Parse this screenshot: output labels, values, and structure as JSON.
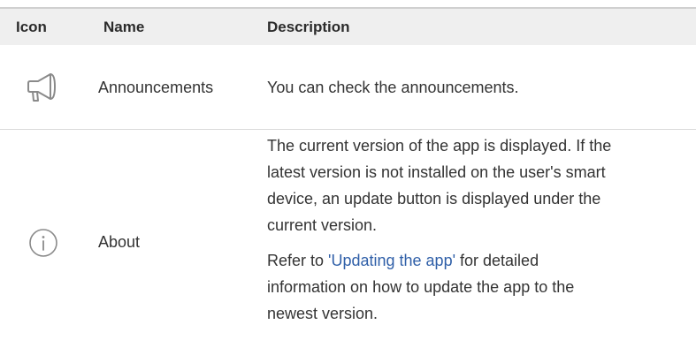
{
  "header": {
    "icon": "Icon",
    "name": "Name",
    "description": "Description"
  },
  "rows": [
    {
      "icon": "megaphone-icon",
      "name": "Announcements",
      "description": "You can check the announcements."
    },
    {
      "icon": "info-icon",
      "name": "About",
      "description_line1": "The current version of the app is displayed. If the",
      "description_line2": "latest version is not installed on the user's smart",
      "description_line3": "device, an update button is displayed under the",
      "description_line4": "current version.",
      "refer_prefix": "Refer to ",
      "refer_link": "'Updating the app'",
      "refer_suffix_line1": " for detailed",
      "refer_line2": "information on how to update the app to the",
      "refer_line3": "newest version."
    }
  ],
  "colors": {
    "header_bg": "#efefef",
    "text": "#333333",
    "link": "#2f5fa8",
    "icon_stroke": "#8a8a8a"
  }
}
